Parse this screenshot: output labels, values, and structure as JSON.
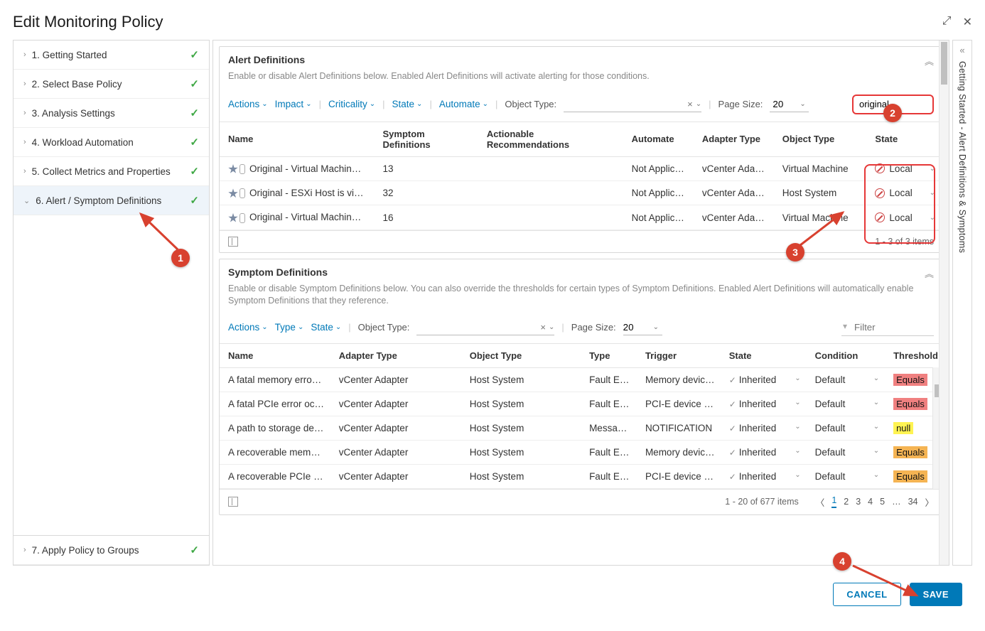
{
  "header": {
    "title": "Edit Monitoring Policy"
  },
  "sidebar": {
    "steps": [
      {
        "label": "1. Getting Started"
      },
      {
        "label": "2. Select Base Policy"
      },
      {
        "label": "3. Analysis Settings"
      },
      {
        "label": "4. Workload Automation"
      },
      {
        "label": "5. Collect Metrics and Properties"
      },
      {
        "label": "6. Alert / Symptom Definitions"
      },
      {
        "label": "7. Apply Policy to Groups"
      }
    ]
  },
  "rail": {
    "text": "Getting Started - Alert Definitions & Symptoms"
  },
  "alertDefs": {
    "title": "Alert Definitions",
    "desc": "Enable or disable Alert Definitions below. Enabled Alert Definitions will activate alerting for those conditions.",
    "filters": {
      "actions": "Actions",
      "impact": "Impact",
      "criticality": "Criticality",
      "state": "State",
      "automate": "Automate",
      "objectType": "Object Type:",
      "pageSize": "Page Size:",
      "pageSizeVal": "20",
      "searchVal": "original"
    },
    "columns": {
      "name": "Name",
      "symptom": "Symptom Definitions",
      "ar": "Actionable Recommendations",
      "automate": "Automate",
      "adapter": "Adapter Type",
      "object": "Object Type",
      "state": "State"
    },
    "rows": [
      {
        "name": "Original - Virtual Machin…",
        "symptom": "13",
        "ar": "",
        "automate": "Not Applica…",
        "adapter": "vCenter Adap…",
        "object": "Virtual Machine",
        "state": "Local"
      },
      {
        "name": "Original - ESXi Host is vi…",
        "symptom": "32",
        "ar": "",
        "automate": "Not Applica…",
        "adapter": "vCenter Adap…",
        "object": "Host System",
        "state": "Local"
      },
      {
        "name": "Original - Virtual Machin…",
        "symptom": "16",
        "ar": "",
        "automate": "Not Applica…",
        "adapter": "vCenter Adap…",
        "object": "Virtual Machine",
        "state": "Local"
      }
    ],
    "footer": "1 - 3 of 3 items"
  },
  "symptomDefs": {
    "title": "Symptom Definitions",
    "desc": "Enable or disable Symptom Definitions below. You can also override the thresholds for certain types of Symptom Definitions. Enabled Alert Definitions will automatically enable Symptom Definitions that they reference.",
    "filters": {
      "actions": "Actions",
      "type": "Type",
      "state": "State",
      "objectType": "Object Type:",
      "pageSize": "Page Size:",
      "pageSizeVal": "20",
      "filterPh": "Filter"
    },
    "columns": {
      "name": "Name",
      "adapter": "Adapter Type",
      "object": "Object Type",
      "type": "Type",
      "trigger": "Trigger",
      "state": "State",
      "condition": "Condition",
      "threshold": "Threshold"
    },
    "rows": [
      {
        "name": "A fatal memory error…",
        "adapter": "vCenter Adapter",
        "object": "Host System",
        "type": "Fault Ev…",
        "trigger": "Memory device…",
        "state": "Inherited",
        "condition": "Default",
        "threshold": "Equals",
        "tclass": "red"
      },
      {
        "name": "A fatal PCIe error oc…",
        "adapter": "vCenter Adapter",
        "object": "Host System",
        "type": "Fault Ev…",
        "trigger": "PCI-E device er…",
        "state": "Inherited",
        "condition": "Default",
        "threshold": "Equals",
        "tclass": "red"
      },
      {
        "name": "A path to storage de…",
        "adapter": "vCenter Adapter",
        "object": "Host System",
        "type": "Messag…",
        "trigger": "NOTIFICATION",
        "state": "Inherited",
        "condition": "Default",
        "threshold": "null",
        "tclass": "yellow"
      },
      {
        "name": "A recoverable memo…",
        "adapter": "vCenter Adapter",
        "object": "Host System",
        "type": "Fault Ev…",
        "trigger": "Memory device…",
        "state": "Inherited",
        "condition": "Default",
        "threshold": "Equals",
        "tclass": "orange"
      },
      {
        "name": "A recoverable PCIe e…",
        "adapter": "vCenter Adapter",
        "object": "Host System",
        "type": "Fault Ev…",
        "trigger": "PCI-E device er…",
        "state": "Inherited",
        "condition": "Default",
        "threshold": "Equals",
        "tclass": "orange"
      }
    ],
    "footer": "1 - 20 of 677 items",
    "pages": [
      "1",
      "2",
      "3",
      "4",
      "5",
      "…",
      "34"
    ]
  },
  "buttons": {
    "cancel": "CANCEL",
    "save": "SAVE"
  }
}
